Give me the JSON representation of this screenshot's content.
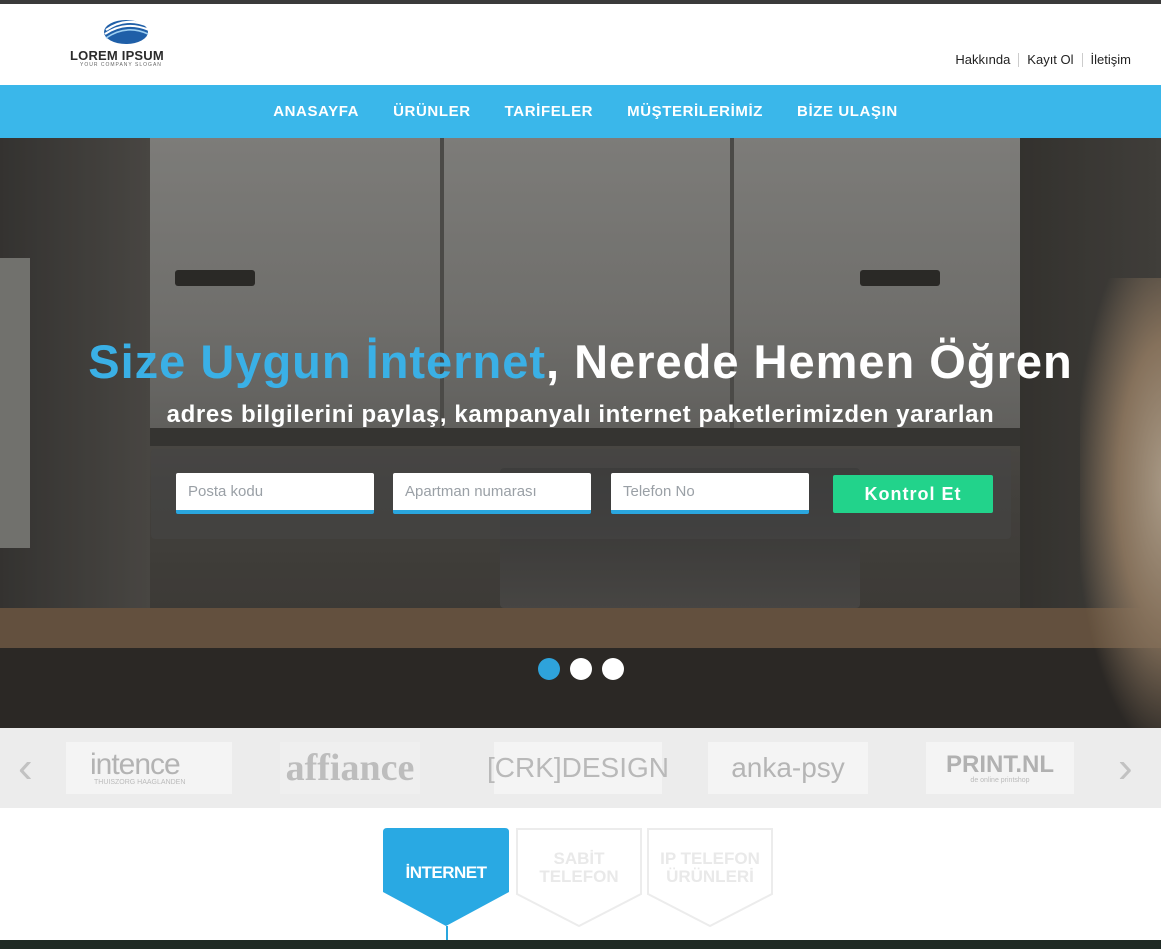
{
  "brand": {
    "name": "LOREM IPSUM",
    "slogan": "YOUR COMPANY SLOGAN"
  },
  "top_links": [
    "Hakkında",
    "Kayıt Ol",
    "İletişim"
  ],
  "nav": [
    "ANASAYFA",
    "ÜRÜNLER",
    "TARİFELER",
    "MÜŞTERİLERİMİZ",
    "BİZE ULAŞIN"
  ],
  "hero": {
    "title_highlight": "Size Uygun İnternet",
    "title_rest": ", Nerede Hemen Öğren",
    "subtitle": "adres bilgilerini paylaş, kampanyalı internet paketlerimizden yararlan",
    "form": {
      "postcode_placeholder": "Posta kodu",
      "apartment_placeholder": "Apartman numarası",
      "phone_placeholder": "Telefon No",
      "submit_label": "Kontrol Et"
    },
    "slides": {
      "count": 3,
      "active_index": 0
    }
  },
  "partners": {
    "prev_arrow": "‹",
    "next_arrow": "›",
    "logos": [
      {
        "main": "intence",
        "sub": "THUISZORG HAAGLANDEN"
      },
      {
        "main": "affiance"
      },
      {
        "main": "[CRK]DESIGN"
      },
      {
        "main": "anka-psy"
      },
      {
        "main": "PRINT.NL",
        "sub": "de online printshop"
      }
    ]
  },
  "product_tabs": [
    {
      "line1": "İNTERNET",
      "line2": "",
      "active": true
    },
    {
      "line1": "SABİT",
      "line2": "TELEFON",
      "active": false
    },
    {
      "line1": "IP TELEFON",
      "line2": "ÜRÜNLERİ",
      "active": false
    }
  ],
  "colors": {
    "accent": "#3ab7ea",
    "button_green": "#22d38b",
    "active_tab": "#29a9e3",
    "dot_active": "#2ea3db"
  }
}
